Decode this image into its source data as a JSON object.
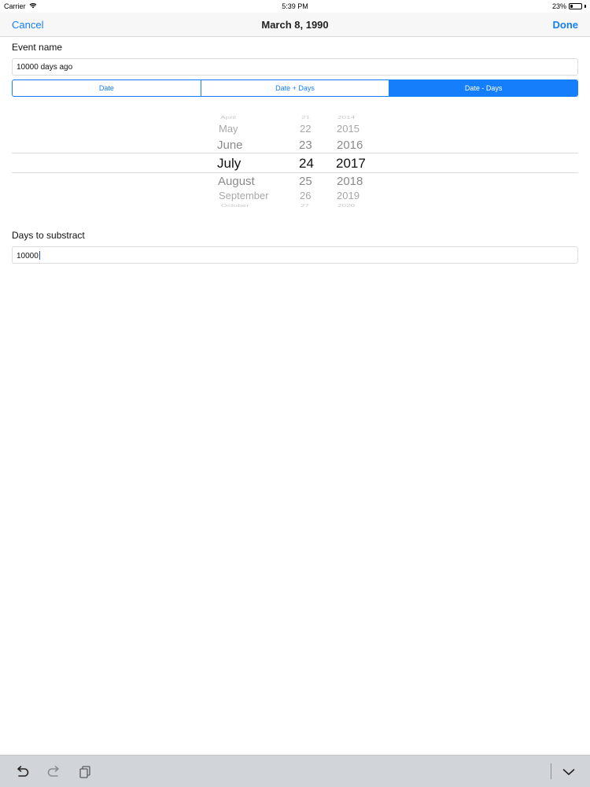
{
  "status_bar": {
    "carrier": "Carrier",
    "time": "5:39 PM",
    "battery_text": "23%",
    "battery_level": 0.23
  },
  "nav": {
    "cancel_label": "Cancel",
    "title": "March 8, 1990",
    "done_label": "Done"
  },
  "event": {
    "label": "Event name",
    "value": "10000 days ago"
  },
  "mode": {
    "segments": [
      "Date",
      "Date + Days",
      "Date - Days"
    ],
    "selected": "Date - Days"
  },
  "picker": {
    "months": [
      "April",
      "May",
      "June",
      "July",
      "August",
      "September",
      "October"
    ],
    "days": [
      "21",
      "22",
      "23",
      "24",
      "25",
      "26",
      "27"
    ],
    "years": [
      "2014",
      "2015",
      "2016",
      "2017",
      "2018",
      "2019",
      "2020"
    ],
    "selected": {
      "month": "July",
      "day": "24",
      "year": "2017"
    }
  },
  "subtract": {
    "label": "Days to substract",
    "value": "10000"
  },
  "toolbar": {
    "icons": [
      "undo-icon",
      "redo-icon",
      "paste-icon",
      "dismiss-keyboard-icon"
    ]
  },
  "colors": {
    "accent": "#157efb",
    "toolbar_bg": "#d1d4d9"
  }
}
